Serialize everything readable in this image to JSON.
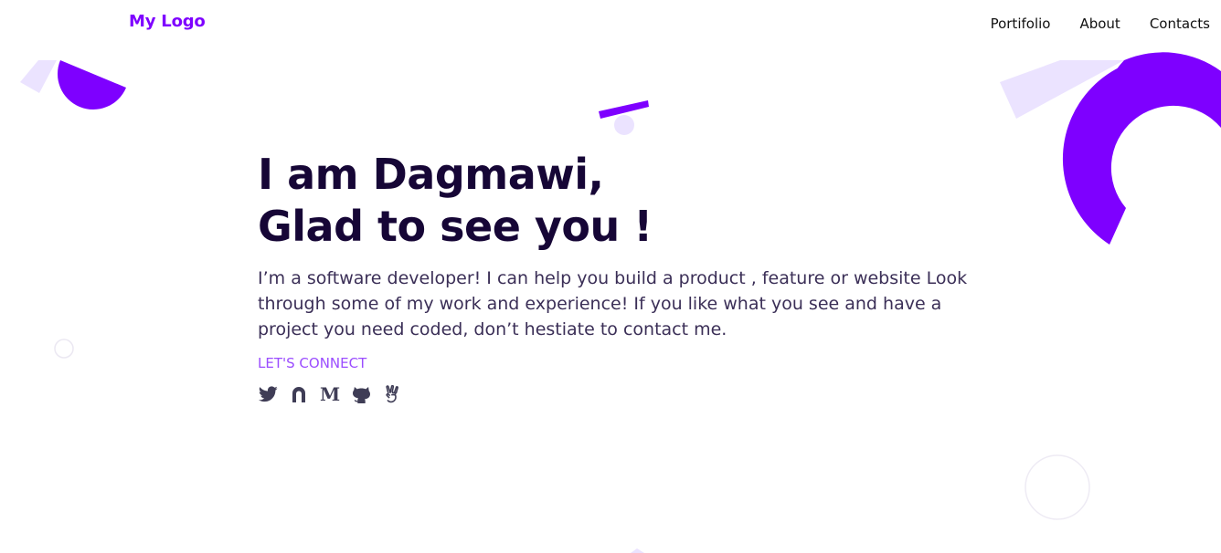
{
  "header": {
    "logo": "My Logo",
    "nav": [
      {
        "label": "Portifolio"
      },
      {
        "label": "About"
      },
      {
        "label": "Contacts"
      }
    ]
  },
  "hero": {
    "title_line1": "I am Dagmawi,",
    "title_line2": "Glad to see you !",
    "description": "I’m a software developer! I can help you build a product , feature or website Look through some of my work and experience! If you like what you see and have a project you need coded, don’t hestiate to contact me.",
    "connect_label": "LET'S CONNECT"
  },
  "socials": [
    {
      "icon": "twitter-icon"
    },
    {
      "icon": "hashnode-icon"
    },
    {
      "icon": "medium-icon",
      "glyph": "M"
    },
    {
      "icon": "github-icon"
    },
    {
      "icon": "angellist-icon"
    }
  ],
  "colors": {
    "accent": "#7e00ff",
    "accent_light": "#ebe3ff",
    "heading": "#160636",
    "body_text": "#3b2f57",
    "link": "#9b4dff",
    "icon": "#3f3d56"
  }
}
